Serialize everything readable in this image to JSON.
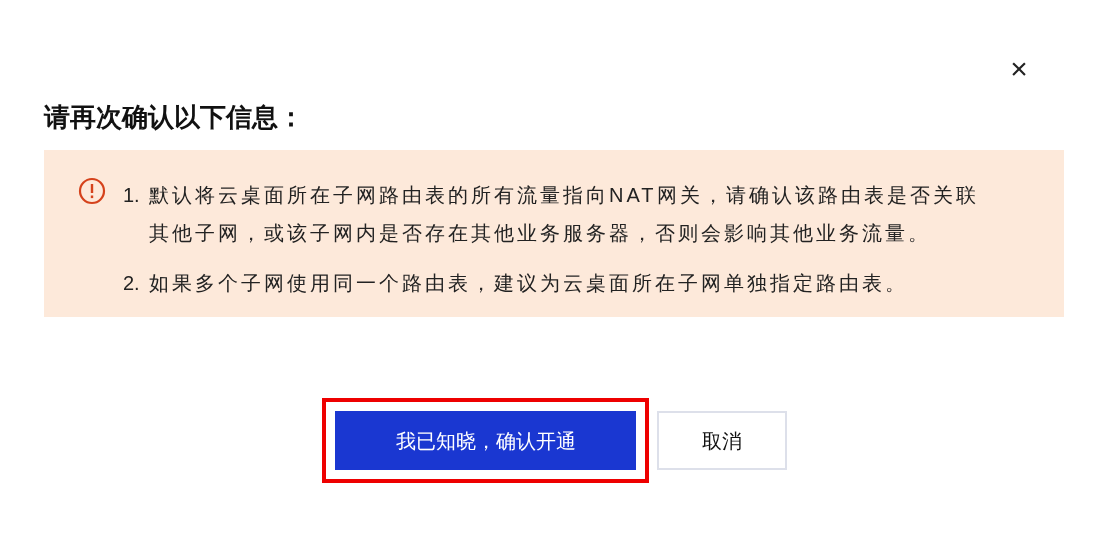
{
  "dialog": {
    "close": "×",
    "title": "请再次确认以下信息：",
    "notice": {
      "items": [
        {
          "number": "1.",
          "text": "默认将云桌面所在子网路由表的所有流量指向NAT网关，请确认该路由表是否关联其他子网，或该子网内是否存在其他业务服务器，否则会影响其他业务流量。"
        },
        {
          "number": "2.",
          "text": "如果多个子网使用同一个路由表，建议为云桌面所在子网单独指定路由表。"
        }
      ]
    },
    "buttons": [
      {
        "kind": "primary",
        "label": "我已知晓，确认开通",
        "highlighted": true
      },
      {
        "kind": "secondary",
        "label": "取消",
        "highlighted": false
      }
    ]
  }
}
